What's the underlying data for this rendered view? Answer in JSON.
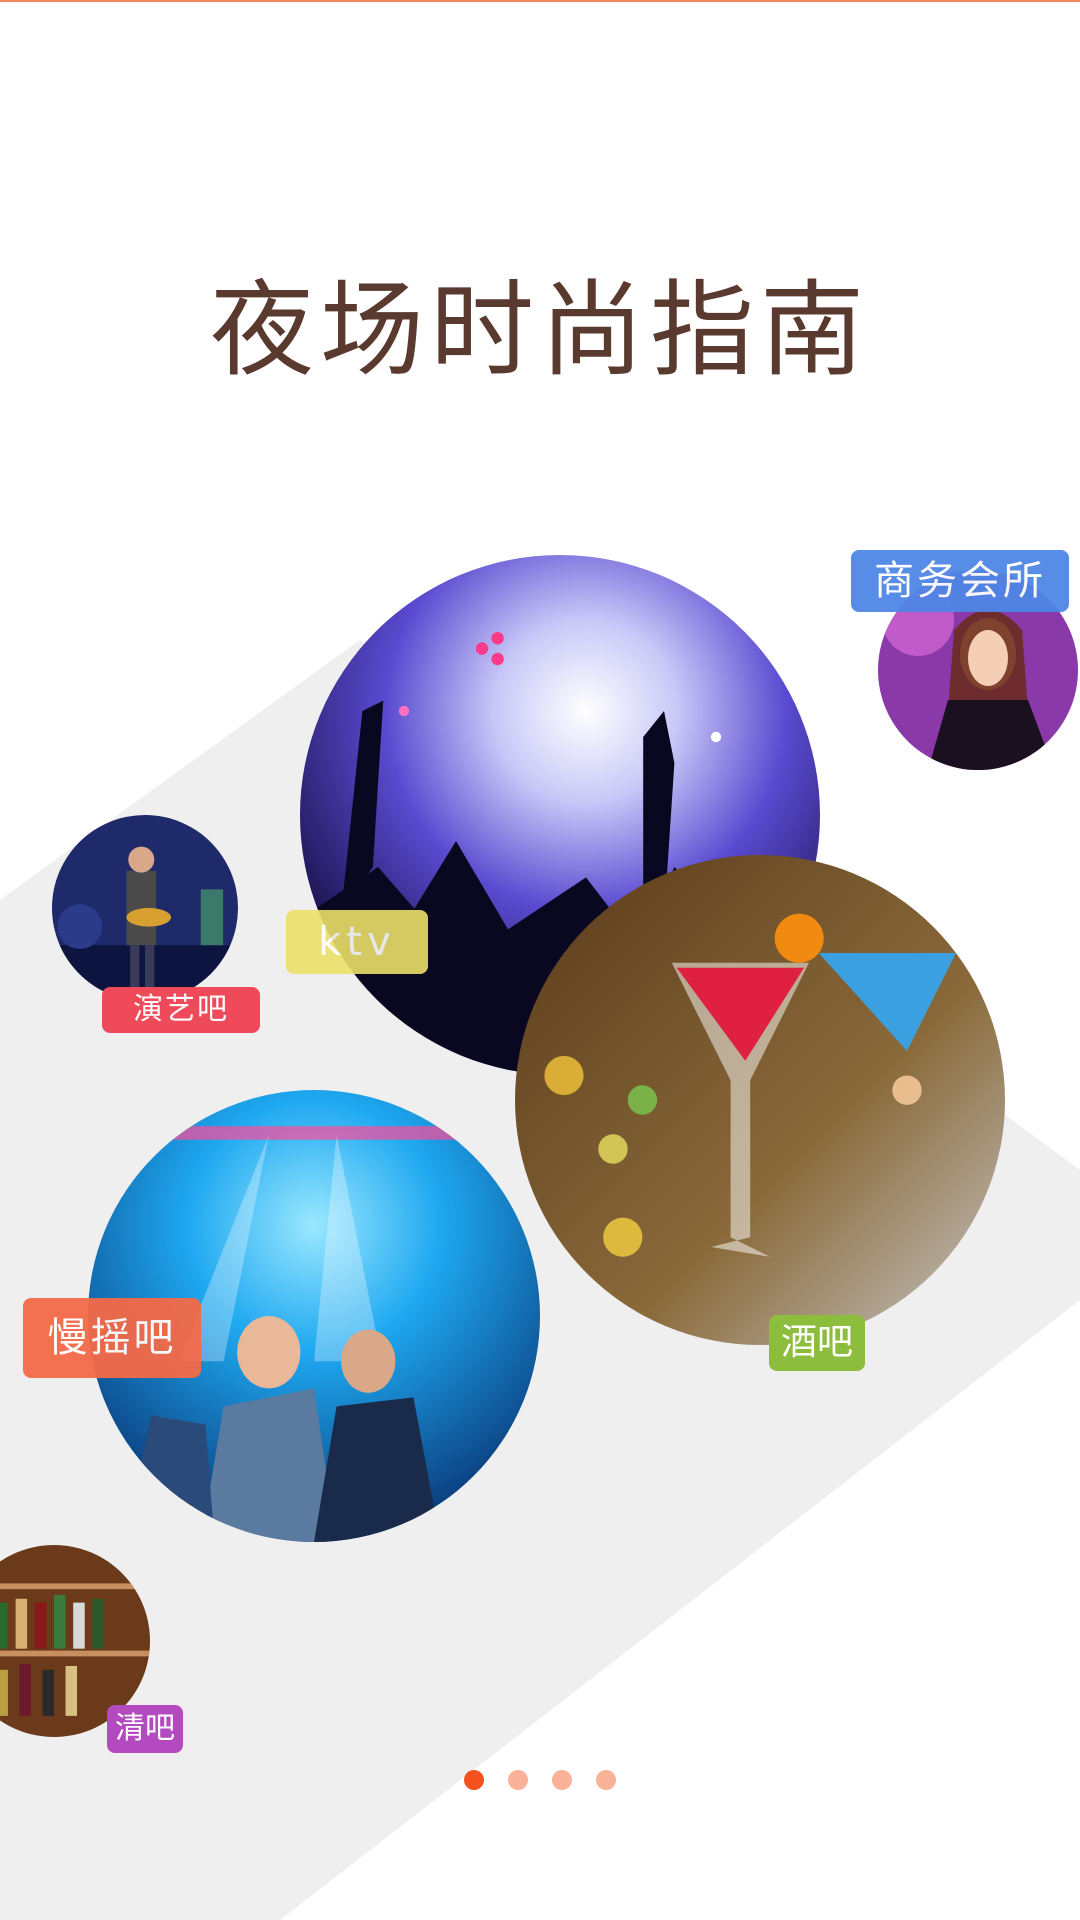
{
  "title": "夜场时尚指南",
  "categories": [
    {
      "label": "商务会所",
      "color": "#4f86e6"
    },
    {
      "label": "ktv",
      "color": "#ece06a"
    },
    {
      "label": "演艺吧",
      "color": "#ef4a5a"
    },
    {
      "label": "慢摇吧",
      "color": "#f46a48"
    },
    {
      "label": "酒吧",
      "color": "#8dbd3c"
    },
    {
      "label": "清吧",
      "color": "#b44ac0"
    }
  ],
  "pager": {
    "total": 4,
    "active": 1,
    "active_color": "#f4511e",
    "inactive_color": "#f9b298"
  }
}
